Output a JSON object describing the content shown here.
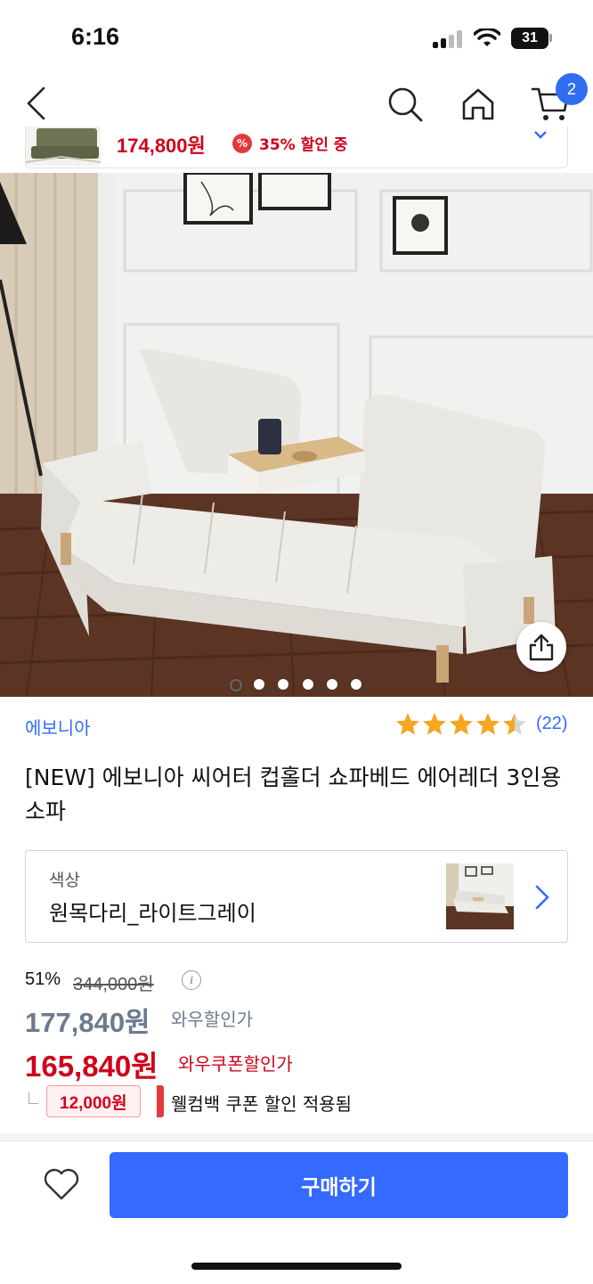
{
  "status_bar": {
    "time": "6:16",
    "battery": "31"
  },
  "nav": {
    "cart_count": "2"
  },
  "mini_banner": {
    "price": "174,800원",
    "discount": "35% 할인 중",
    "discount_icon": "%"
  },
  "gallery": {
    "image_count": 6,
    "active_index": 0
  },
  "product": {
    "brand": "에보니아",
    "rating": 4.5,
    "review_count": "(22)",
    "title": "[NEW] 에보니아 씨어터 컵홀더 쇼파베드 에어레더 3인용소파"
  },
  "option": {
    "label": "색상",
    "value": "원목다리_라이트그레이"
  },
  "pricing": {
    "discount_rate": "51%",
    "original_price": "344,000원",
    "info_icon": "i",
    "wow_price": "177,840원",
    "wow_label": "와우할인가",
    "coupon_price": "165,840원",
    "coupon_label": "와우쿠폰할인가",
    "coupon_amount": "12,000원",
    "coupon_desc": "웰컴백 쿠폰 할인 적용됨"
  },
  "bottom": {
    "buy_label": "구매하기"
  },
  "colors": {
    "accent": "#346aff",
    "price_red": "#d0021b",
    "wow_gray": "#6b7b8e",
    "star": "#f5a623"
  }
}
